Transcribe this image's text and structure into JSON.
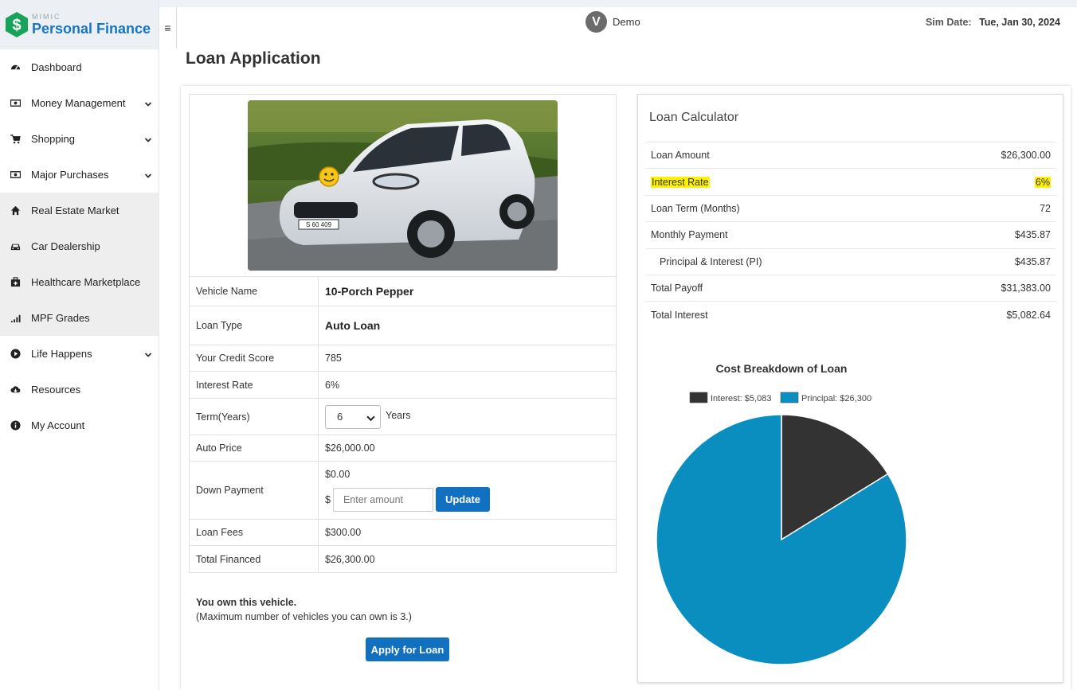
{
  "brand": {
    "small": "MIMIC",
    "name": "Personal Finance"
  },
  "sidebar": {
    "items": [
      {
        "label": "Dashboard",
        "icon": "dashboard-icon",
        "chevron": false,
        "shaded": false
      },
      {
        "label": "Money Management",
        "icon": "money-icon",
        "chevron": true,
        "shaded": false
      },
      {
        "label": "Shopping",
        "icon": "cart-icon",
        "chevron": true,
        "shaded": false
      },
      {
        "label": "Major Purchases",
        "icon": "money-icon",
        "chevron": true,
        "shaded": false
      },
      {
        "label": "Real Estate Market",
        "icon": "home-icon",
        "chevron": false,
        "shaded": true
      },
      {
        "label": "Car Dealership",
        "icon": "car-icon",
        "chevron": false,
        "shaded": true
      },
      {
        "label": "Healthcare Marketplace",
        "icon": "medkit-icon",
        "chevron": false,
        "shaded": true
      },
      {
        "label": "MPF Grades",
        "icon": "signal-icon",
        "chevron": false,
        "shaded": true
      },
      {
        "label": "Life Happens",
        "icon": "play-circle-icon",
        "chevron": true,
        "shaded": false
      },
      {
        "label": "Resources",
        "icon": "cloud-download-icon",
        "chevron": false,
        "shaded": false
      },
      {
        "label": "My Account",
        "icon": "info-circle-icon",
        "chevron": false,
        "shaded": false
      }
    ]
  },
  "header": {
    "menu_glyph": "≡",
    "user_initial": "V",
    "user_name": "Demo",
    "sim_date_label": "Sim Date:",
    "sim_date_value": "Tue, Jan 30, 2024"
  },
  "page": {
    "title": "Loan Application"
  },
  "details": {
    "vehicle_name_label": "Vehicle Name",
    "vehicle_name": "10-Porch Pepper",
    "loan_type_label": "Loan Type",
    "loan_type": "Auto Loan",
    "credit_score_label": "Your Credit Score",
    "credit_score": "785",
    "interest_rate_label": "Interest Rate",
    "interest_rate": "6%",
    "term_label": "Term(Years)",
    "term_value": "6",
    "term_unit": "Years",
    "auto_price_label": "Auto Price",
    "auto_price": "$26,000.00",
    "down_payment_label": "Down Payment",
    "down_payment": "$0.00",
    "currency_symbol": "$",
    "amount_placeholder": "Enter amount",
    "update_label": "Update",
    "loan_fees_label": "Loan Fees",
    "loan_fees": "$300.00",
    "total_financed_label": "Total Financed",
    "total_financed": "$26,300.00",
    "license_plate": "S 60 409"
  },
  "ownership": {
    "line1": "You own this vehicle.",
    "line2": "(Maximum number of vehicles you can own is 3.)"
  },
  "apply_label": "Apply for Loan",
  "calculator": {
    "title": "Loan Calculator",
    "rows": [
      {
        "label": "Loan Amount",
        "value": "$26,300.00"
      },
      {
        "label": "Interest Rate",
        "value": "6%"
      },
      {
        "label": "Loan Term (Months)",
        "value": "72"
      },
      {
        "label": "Monthly Payment",
        "value": "$435.87"
      },
      {
        "label": "Principal & Interest (PI)",
        "value": "$435.87"
      },
      {
        "label": "Total Payoff",
        "value": "$31,383.00"
      },
      {
        "label": "Total Interest",
        "value": "$5,082.64"
      }
    ]
  },
  "colors": {
    "accent": "#1270c0",
    "brand_blue": "#1676c2",
    "interest": "#333333",
    "principal": "#0a8ec0",
    "highlight": "#fff200"
  },
  "chart_data": {
    "type": "pie",
    "title": "Cost Breakdown of Loan",
    "legend_position": "top",
    "series": [
      {
        "name": "Interest: $5,083",
        "value": 5083,
        "color": "#333333"
      },
      {
        "name": "Principal: $26,300",
        "value": 26300,
        "color": "#0a8ec0"
      }
    ]
  }
}
